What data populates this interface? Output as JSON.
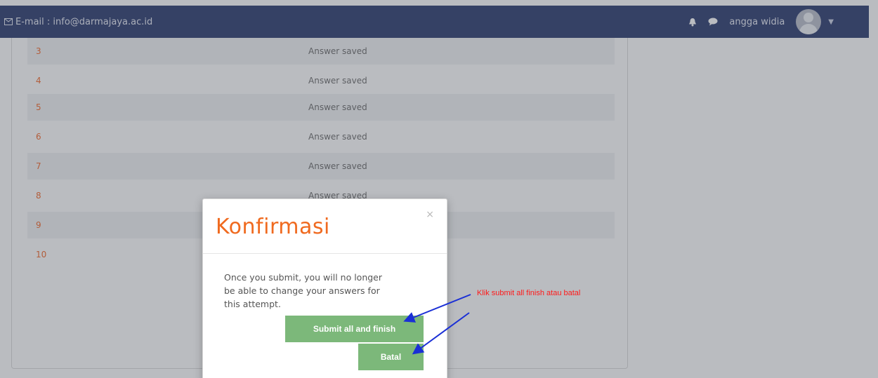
{
  "navbar": {
    "email": "E-mail : info@darmajaya.ac.id",
    "user_name": "angga widia",
    "icons": [
      "mail-icon",
      "bell-icon",
      "chat-icon",
      "avatar",
      "caret-down-icon"
    ]
  },
  "rows": [
    {
      "num": "3",
      "status": "Answer saved"
    },
    {
      "num": "4",
      "status": "Answer saved"
    },
    {
      "num": "5",
      "status": "Answer saved"
    },
    {
      "num": "6",
      "status": "Answer saved"
    },
    {
      "num": "7",
      "status": "Answer saved"
    },
    {
      "num": "8",
      "status": "Answer saved"
    },
    {
      "num": "9",
      "status": ""
    },
    {
      "num": "10",
      "status": ""
    }
  ],
  "modal": {
    "title": "Konfirmasi",
    "close": "×",
    "message": "Once you submit, you will no longer be able to change your answers for this attempt.",
    "submit_label": "Submit all and finish",
    "cancel_label": "Batal"
  },
  "annotation": {
    "text": "Klik submit all finish atau batal",
    "color": "#ff1a1a",
    "arrow_color": "#1a2fd6"
  },
  "colors": {
    "navbar_bg": "#3b4a7a",
    "accent_orange": "#f06a1f",
    "button_green": "#7cb87a"
  }
}
